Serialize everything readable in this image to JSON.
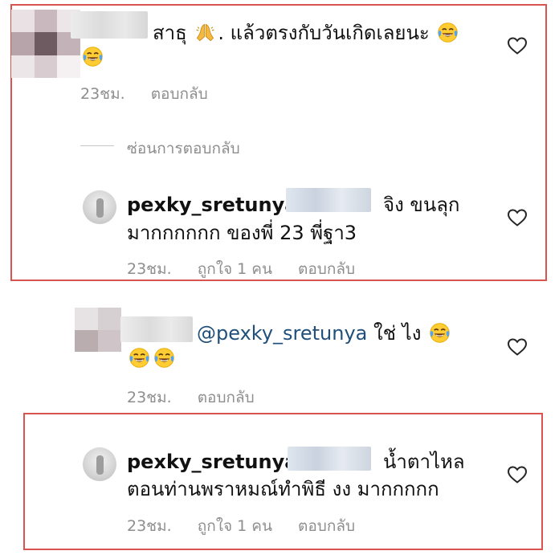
{
  "comment1": {
    "text": "สาธุ",
    "text2": ". แล้วตรงกับวันเกิดเลยนะ",
    "time": "23ชม.",
    "reply": "ตอบกลับ"
  },
  "hide_replies": "ซ่อนการตอบกลับ",
  "reply1": {
    "username": "pexky_sretunya",
    "line1": "จิง ขนลุก",
    "line2": "มากกกกกก  ของพี่ 23 พี่ฐา3",
    "time": "23ชม.",
    "likes": "ถูกใจ 1 คน",
    "reply": "ตอบกลับ"
  },
  "comment2": {
    "mention": "@pexky_sretunya",
    "text": "ใช่ ไง",
    "time": "23ชม.",
    "reply": "ตอบกลับ"
  },
  "reply2": {
    "username": "pexky_sretunya",
    "line1": "น้ำตาไหล",
    "line2": "ตอนท่านพราหมณ์ทำพิธี งง มากกกกก",
    "time": "23ชม.",
    "likes": "ถูกใจ 1 คน",
    "reply": "ตอบกลับ"
  },
  "icons": {
    "heart": "heart-outline-icon",
    "pray": "folded-hands-emoji",
    "laugh": "tears-of-joy-emoji"
  },
  "colors": {
    "highlight_border": "#d9534f",
    "mention": "#1f4f7a",
    "meta": "#8e8e8e"
  }
}
